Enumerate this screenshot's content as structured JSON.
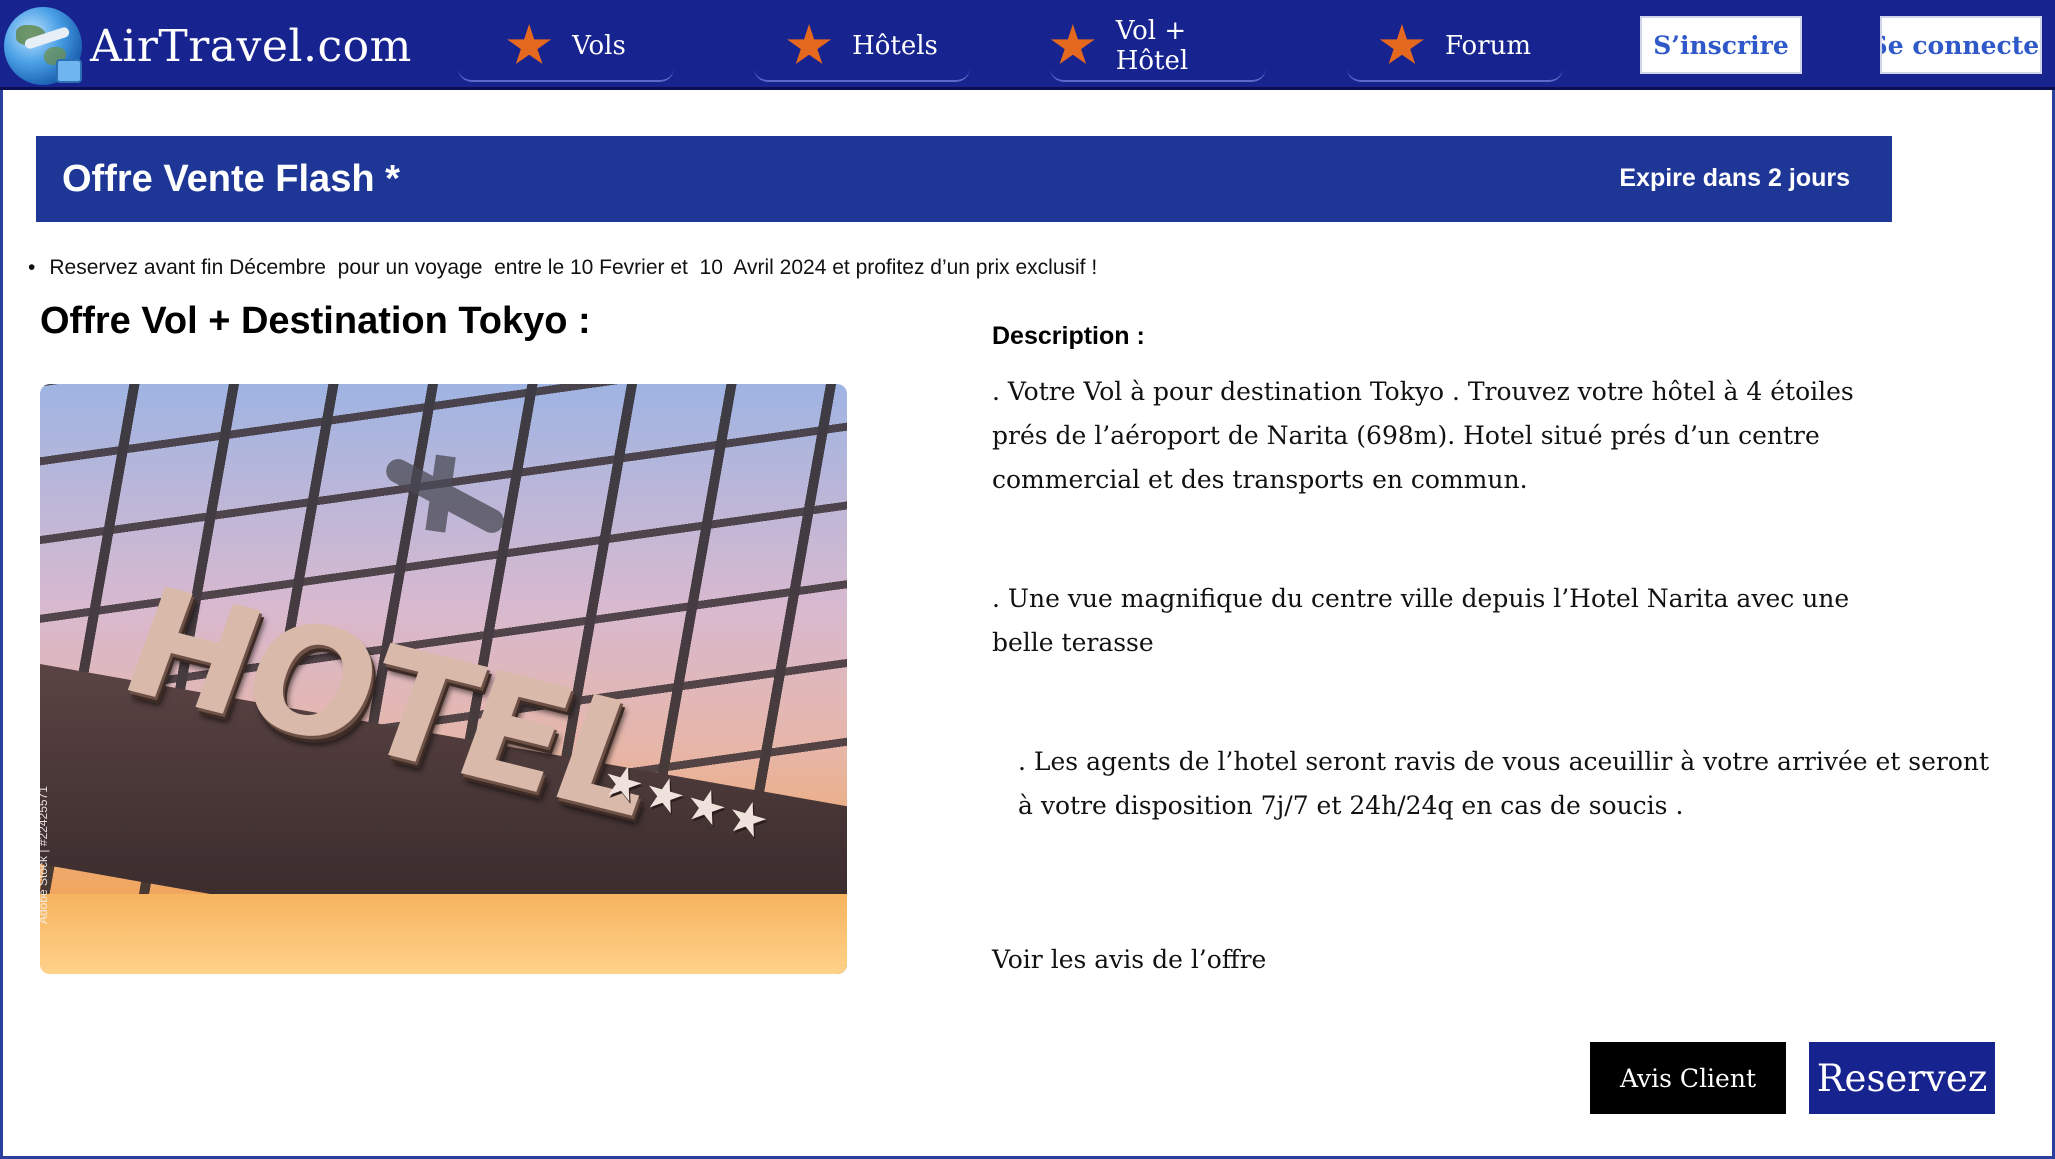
{
  "header": {
    "logo_text": "AirTravel.com",
    "nav": [
      {
        "label": "Vols",
        "icon": "star-icon"
      },
      {
        "label": "Hôtels",
        "icon": "star-icon"
      },
      {
        "label": "Vol + Hôtel",
        "icon": "star-icon"
      },
      {
        "label": "Forum",
        "icon": "star-icon"
      }
    ],
    "signup_label": "S’inscrire",
    "login_label": "Se connecter"
  },
  "banner": {
    "title": "Offre Vente Flash *",
    "expires": "Expire dans 2 jours"
  },
  "notice": "Reservez avant fin Décembre  pour un voyage  entre le 10 Fevrier et  10  Avril 2024 et profitez d’un prix exclusif !",
  "offer": {
    "title": "Offre Vol + Destination Tokyo :",
    "image": {
      "sign_text": "HOTEL",
      "stars": "★★★★",
      "credit": "Adobe Stock  |  #22425571"
    }
  },
  "description": {
    "title": "Description :",
    "paragraphs": [
      ". Votre Vol à pour destination Tokyo . Trouvez votre hôtel à 4 étoiles prés de l’aéroport de Narita (698m). Hotel situé prés d’un centre commercial et des transports en commun.",
      ". Une  vue magnifique du centre ville depuis l’Hotel Narita avec une belle terasse",
      ". Les agents de l’hotel seront ravis de vous aceuillir à votre arrivée et seront à votre disposition 7j/7 et 24h/24q en cas de soucis ."
    ],
    "reviews_link": "Voir les avis  de l’offre"
  },
  "actions": {
    "reviews_button": "Avis Client",
    "reserve_button": "Reservez"
  },
  "colors": {
    "nav_bg": "#17238f",
    "banner_bg": "#1e3797",
    "star": "#e5681f",
    "link_blue": "#2f58c9"
  }
}
